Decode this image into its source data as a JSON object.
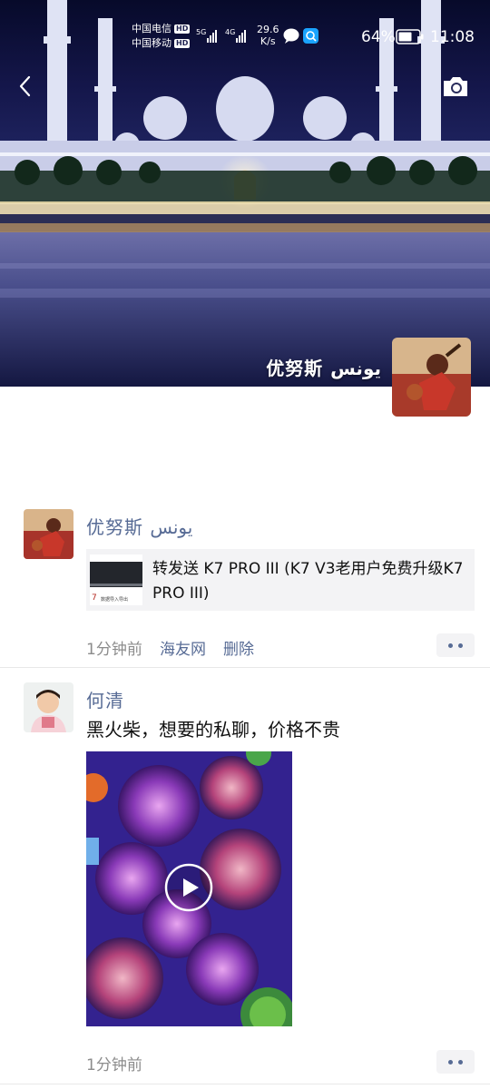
{
  "status_bar": {
    "carrier1": "中国电信",
    "carrier2": "中国移动",
    "hd": "HD",
    "net1": "5G",
    "net2": "4G",
    "speed_value": "29.6",
    "speed_unit": "K/s",
    "battery": "64%",
    "time": "11:08"
  },
  "header": {
    "back_icon": "chevron-left-icon",
    "camera_icon": "camera-icon",
    "user_name": "优努斯 يونس"
  },
  "posts": [
    {
      "author": "优努斯 يونس",
      "link": {
        "title": "转发送 K7 PRO III (K7 V3老用户免费升级K7 PRO III)",
        "thumb_text": "数据导入导出"
      },
      "time": "1分钟前",
      "source": "海友网",
      "delete_label": "删除"
    },
    {
      "author": "何清",
      "text": "黑火柴，想要的私聊，价格不贵",
      "time": "1分钟前"
    }
  ],
  "colors": {
    "link_blue": "#576b95",
    "card_bg": "#f3f3f5",
    "meta_gray": "#8c8c8c"
  }
}
